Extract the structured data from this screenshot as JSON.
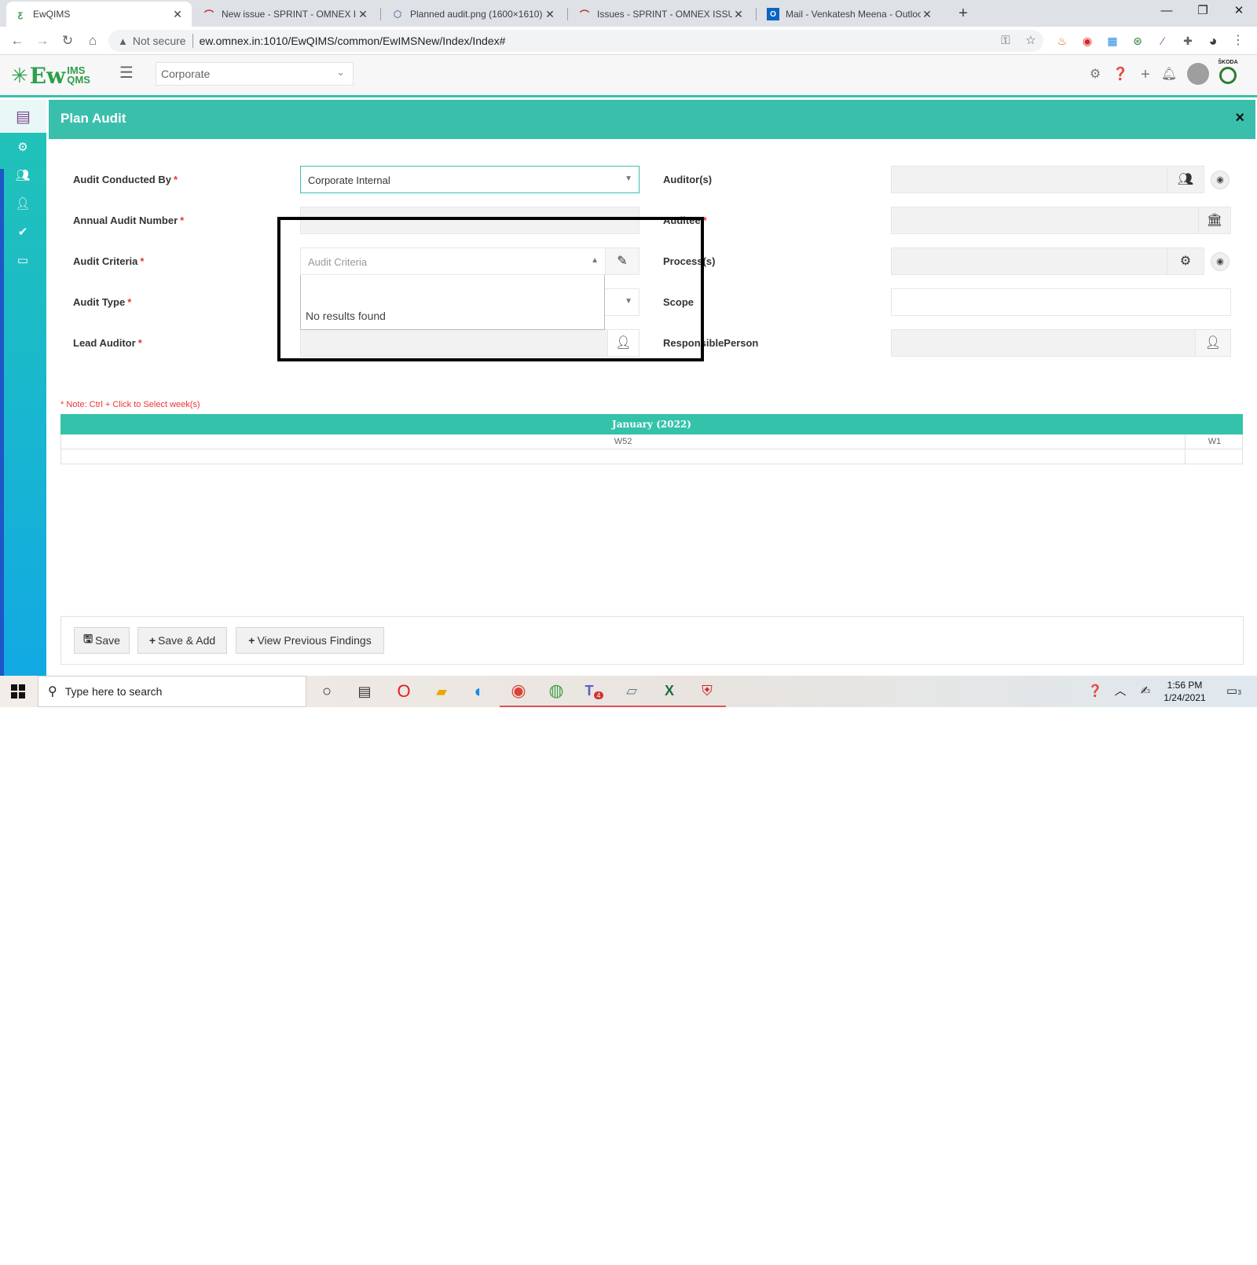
{
  "browser": {
    "tabs": [
      {
        "title": "EwQIMS",
        "favicon": "ewqims-icon",
        "active": true
      },
      {
        "title": "New issue - SPRINT - OMNEX ISSUE",
        "favicon": "redmine-icon",
        "active": false
      },
      {
        "title": "Planned audit.png (1600×1610)",
        "favicon": "image-viewer-icon",
        "active": false
      },
      {
        "title": "Issues - SPRINT - OMNEX ISSUE",
        "favicon": "redmine-icon",
        "active": false
      },
      {
        "title": "Mail - Venkatesh Meena - Outlook",
        "favicon": "outlook-icon",
        "active": false
      }
    ],
    "security_label": "Not secure",
    "url": "ew.omnex.in:1010/EwQIMS/common/EwIMSNew/Index/Index#"
  },
  "app": {
    "logo_main": "Ew",
    "logo_top": "IMS",
    "logo_bottom": "QMS",
    "corporate_selector": "Corporate",
    "brand_badge": "ŠKODA"
  },
  "panel": {
    "title": "Plan Audit",
    "close_label": "×"
  },
  "form": {
    "required_mark": "*",
    "audit_conducted_by": {
      "label": "Audit Conducted By",
      "value": "Corporate Internal"
    },
    "annual_audit_number": {
      "label": "Annual Audit Number",
      "value": ""
    },
    "audit_criteria": {
      "label": "Audit Criteria",
      "placeholder": "Audit Criteria",
      "no_results": "No results found"
    },
    "audit_type": {
      "label": "Audit Type",
      "value": ""
    },
    "lead_auditor": {
      "label": "Lead Auditor",
      "value": ""
    },
    "auditors": {
      "label": "Auditor(s)",
      "value": ""
    },
    "auditee": {
      "label": "Auditee",
      "value": ""
    },
    "processes": {
      "label": "Process(s)",
      "value": ""
    },
    "scope": {
      "label": "Scope",
      "value": ""
    },
    "responsible_person": {
      "label": "ResponsiblePerson",
      "value": ""
    }
  },
  "calendar": {
    "note": "* Note: Ctrl + Click to Select week(s)",
    "month_header": "January (2022)",
    "weeks": [
      "W52",
      "W1"
    ]
  },
  "buttons": {
    "save": "Save",
    "save_add": "Save & Add",
    "view_previous_findings": "View Previous Findings"
  },
  "taskbar": {
    "search_placeholder": "Type here to search",
    "time": "1:56 PM",
    "date": "1/24/2021",
    "teams_badge": "4",
    "notifications_count": "3"
  },
  "colors": {
    "accent": "#3bbfad",
    "required": "#ee3333",
    "sidebar_blue": "#1d56c7"
  }
}
